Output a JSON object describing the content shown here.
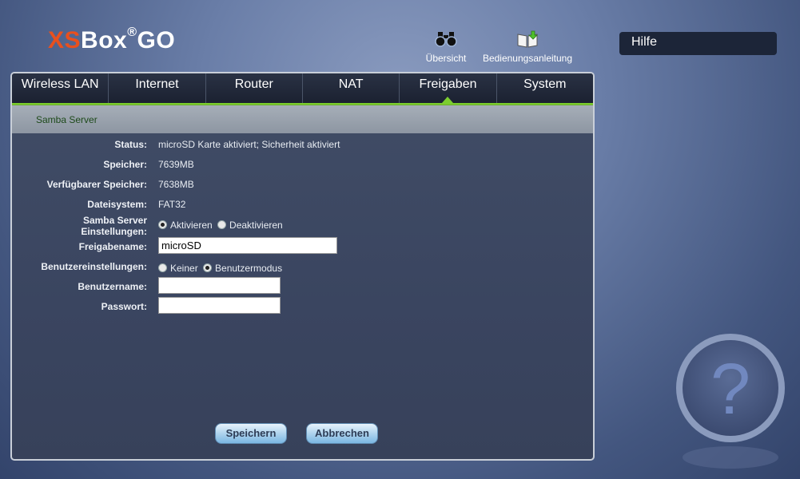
{
  "brand": {
    "prefix": "XS",
    "name": "Box",
    "reg": "®",
    "suffix": "GO"
  },
  "top_links": {
    "overview": "Übersicht",
    "manual": "Bedienungsanleitung"
  },
  "help": {
    "label": "Hilfe"
  },
  "tabs": [
    "Wireless LAN",
    "Internet",
    "Router",
    "NAT",
    "Freigaben",
    "System"
  ],
  "active_tab": "Freigaben",
  "section_title": "Samba Server",
  "form": {
    "status_label": "Status:",
    "status_value": "microSD Karte aktiviert; Sicherheit aktiviert",
    "memory_label": "Speicher:",
    "memory_value": "7639MB",
    "free_label": "Verfügbarer Speicher:",
    "free_value": "7638MB",
    "fs_label": "Dateisystem:",
    "fs_value": "FAT32",
    "samba_label": "Samba Server Einstellungen:",
    "samba_on": "Aktivieren",
    "samba_off": "Deaktivieren",
    "share_label": "Freigabename:",
    "share_value": "microSD",
    "user_settings_label": "Benutzereinstellungen:",
    "user_none": "Keiner",
    "user_mode": "Benutzermodus",
    "username_label": "Benutzername:",
    "username_value": "",
    "password_label": "Passwort:",
    "password_value": ""
  },
  "buttons": {
    "save": "Speichern",
    "cancel": "Abbrechen"
  },
  "colors": {
    "brand_orange": "#e8501e",
    "accent_green": "#7ccd2e",
    "panel": "#3a4560"
  }
}
